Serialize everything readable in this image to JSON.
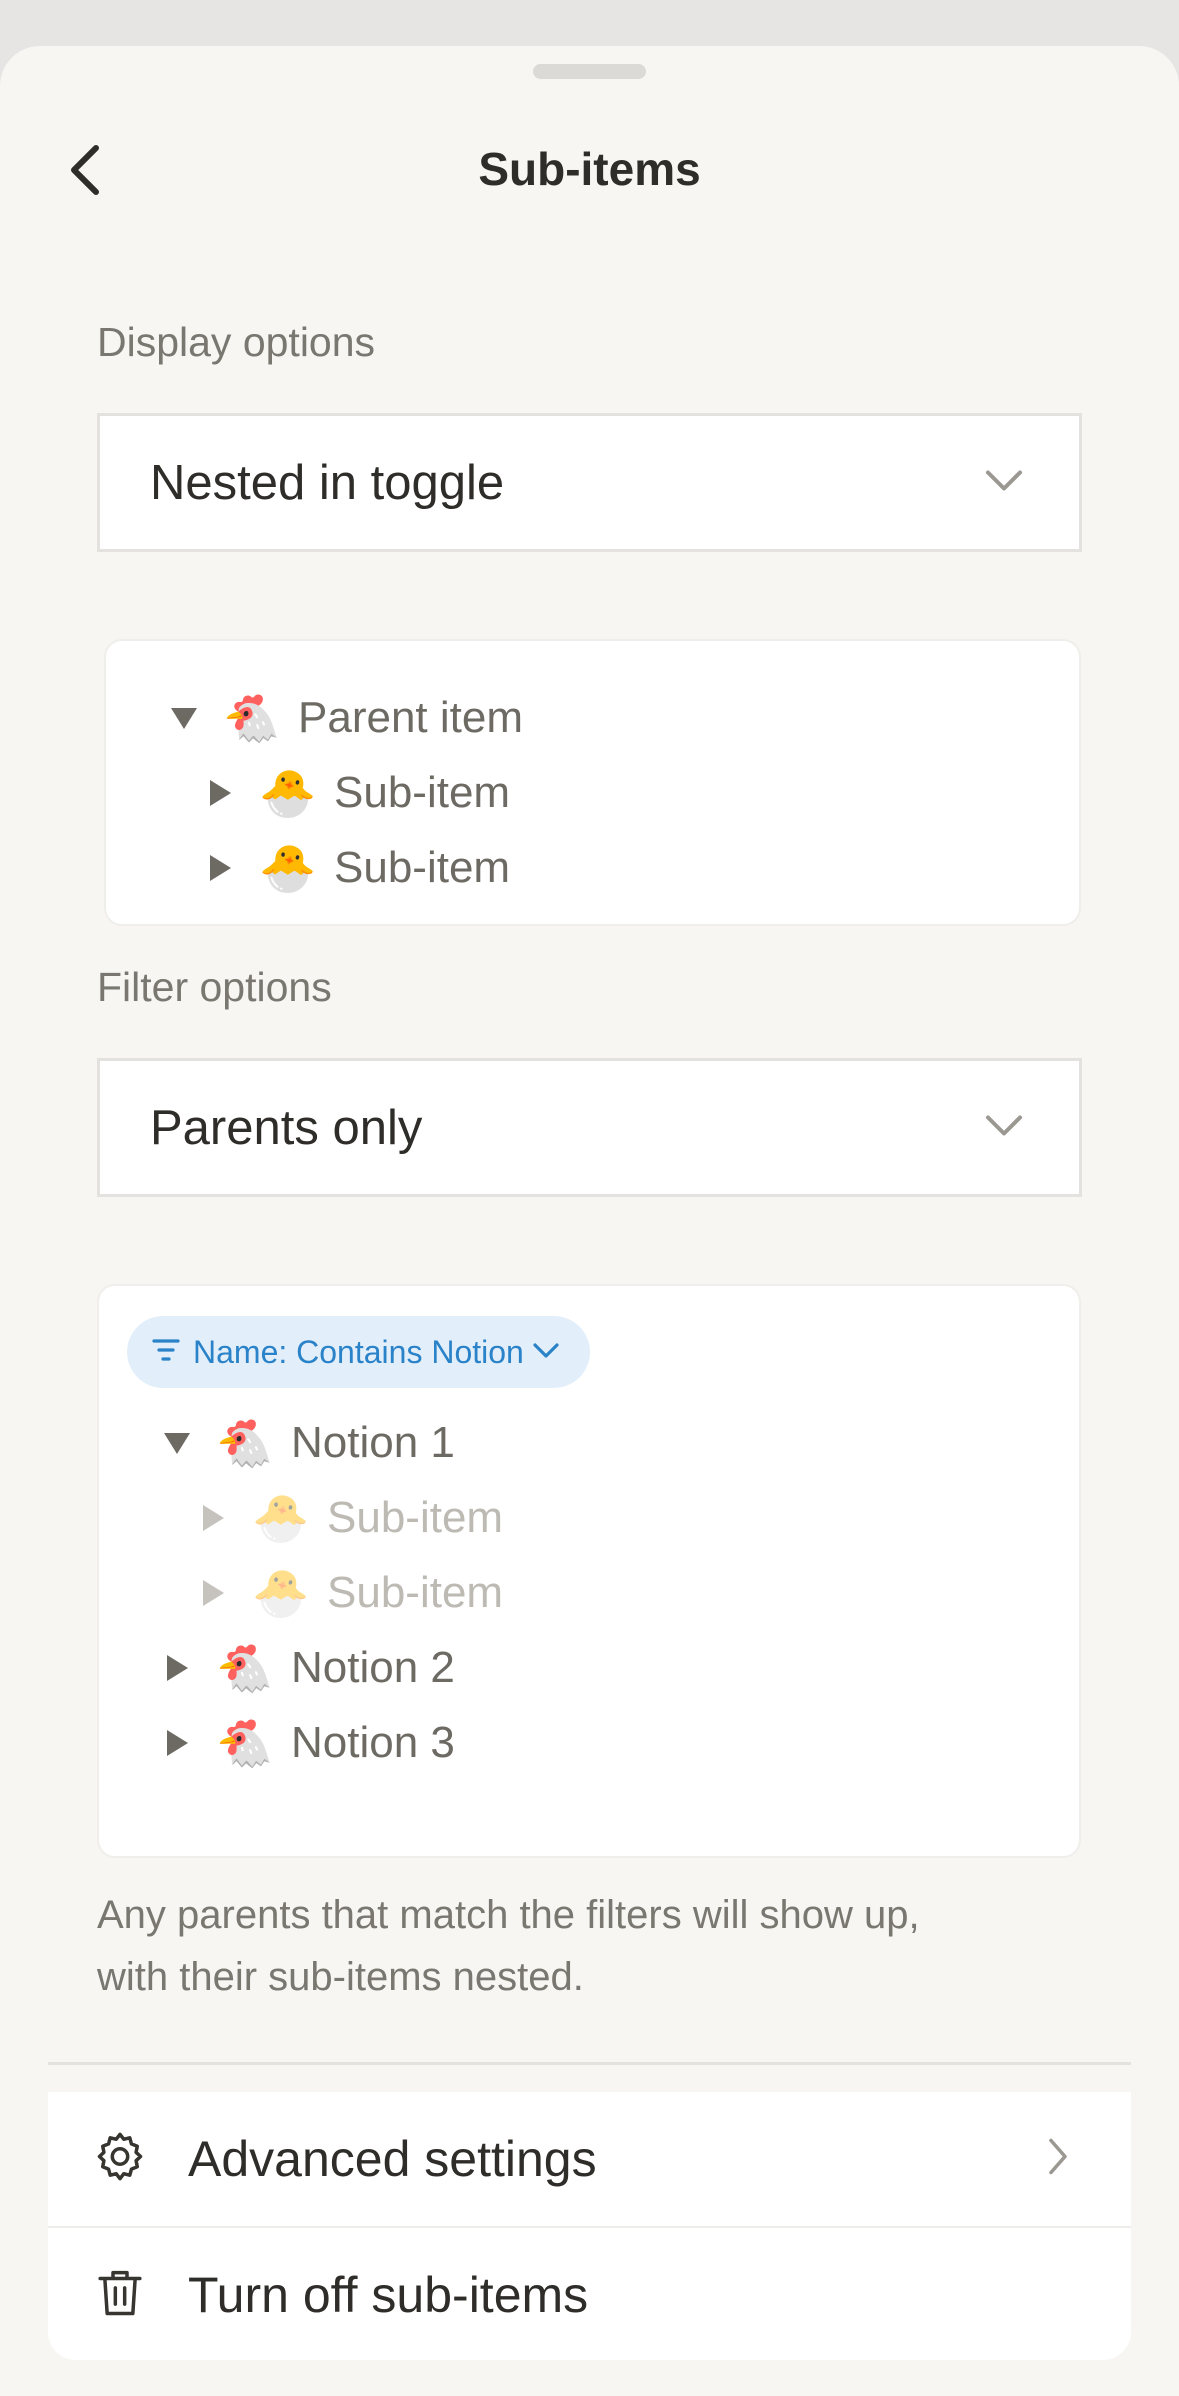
{
  "header": {
    "title": "Sub-items",
    "back_icon": "chevron-left-icon"
  },
  "display": {
    "label": "Display options",
    "selected": "Nested in toggle",
    "preview": [
      {
        "label": "Parent item",
        "emoji": "🐔",
        "level": 0,
        "expanded": true
      },
      {
        "label": "Sub-item",
        "emoji": "🐣",
        "level": 1,
        "expanded": false
      },
      {
        "label": "Sub-item",
        "emoji": "🐣",
        "level": 1,
        "expanded": false
      }
    ]
  },
  "filter": {
    "label": "Filter options",
    "selected": "Parents only",
    "chip": "Name: Contains Notion",
    "preview": [
      {
        "label": "Notion 1",
        "emoji": "🐔",
        "level": 0,
        "expanded": true,
        "faded": false
      },
      {
        "label": "Sub-item",
        "emoji": "🐣",
        "level": 1,
        "expanded": false,
        "faded": true
      },
      {
        "label": "Sub-item",
        "emoji": "🐣",
        "level": 1,
        "expanded": false,
        "faded": true
      },
      {
        "label": "Notion 2",
        "emoji": "🐔",
        "level": 0,
        "expanded": false,
        "faded": false
      },
      {
        "label": "Notion 3",
        "emoji": "🐔",
        "level": 0,
        "expanded": false,
        "faded": false
      }
    ],
    "help_line_1": "Any parents that match the filters will show up,",
    "help_line_2": "with their sub-items nested."
  },
  "menu": {
    "advanced": {
      "label": "Advanced settings",
      "icon": "gear-icon"
    },
    "turn_off": {
      "label": "Turn off sub-items",
      "icon": "trash-icon"
    }
  },
  "colors": {
    "accent": "#2a82c8",
    "chip_bg": "#e2effa",
    "sheet_bg": "#f7f6f3"
  }
}
